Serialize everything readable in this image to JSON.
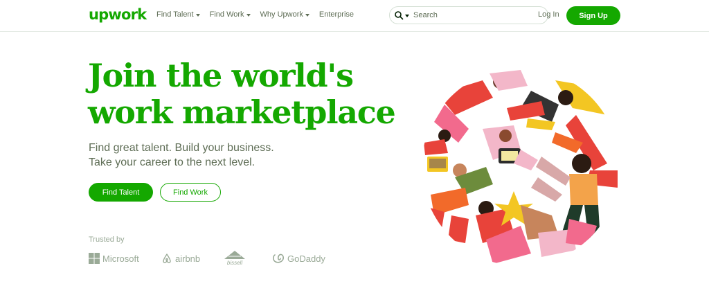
{
  "header": {
    "logo": "upwork",
    "nav": [
      {
        "label": "Find Talent",
        "has_dropdown": true
      },
      {
        "label": "Find Work",
        "has_dropdown": true
      },
      {
        "label": "Why Upwork",
        "has_dropdown": true
      },
      {
        "label": "Enterprise",
        "has_dropdown": false
      }
    ],
    "search": {
      "placeholder": "Search",
      "value": ""
    },
    "login_label": "Log In",
    "signup_label": "Sign Up"
  },
  "hero": {
    "headline_line1": "Join the world's",
    "headline_line2": "work marketplace",
    "subhead_line1": "Find great talent. Build your business.",
    "subhead_line2": "Take your career to the next level.",
    "primary_button": "Find Talent",
    "secondary_button": "Find Work"
  },
  "trusted": {
    "label": "Trusted by",
    "brands": [
      "Microsoft",
      "airbnb",
      "bissell",
      "GoDaddy"
    ]
  },
  "colors": {
    "brand_green": "#14a800",
    "text_muted": "#5e6d55",
    "logo_gray": "#9aaa97"
  },
  "icons": {
    "search": "search-icon",
    "dropdown": "caret-down-icon",
    "illustration": "hero-illustration"
  }
}
